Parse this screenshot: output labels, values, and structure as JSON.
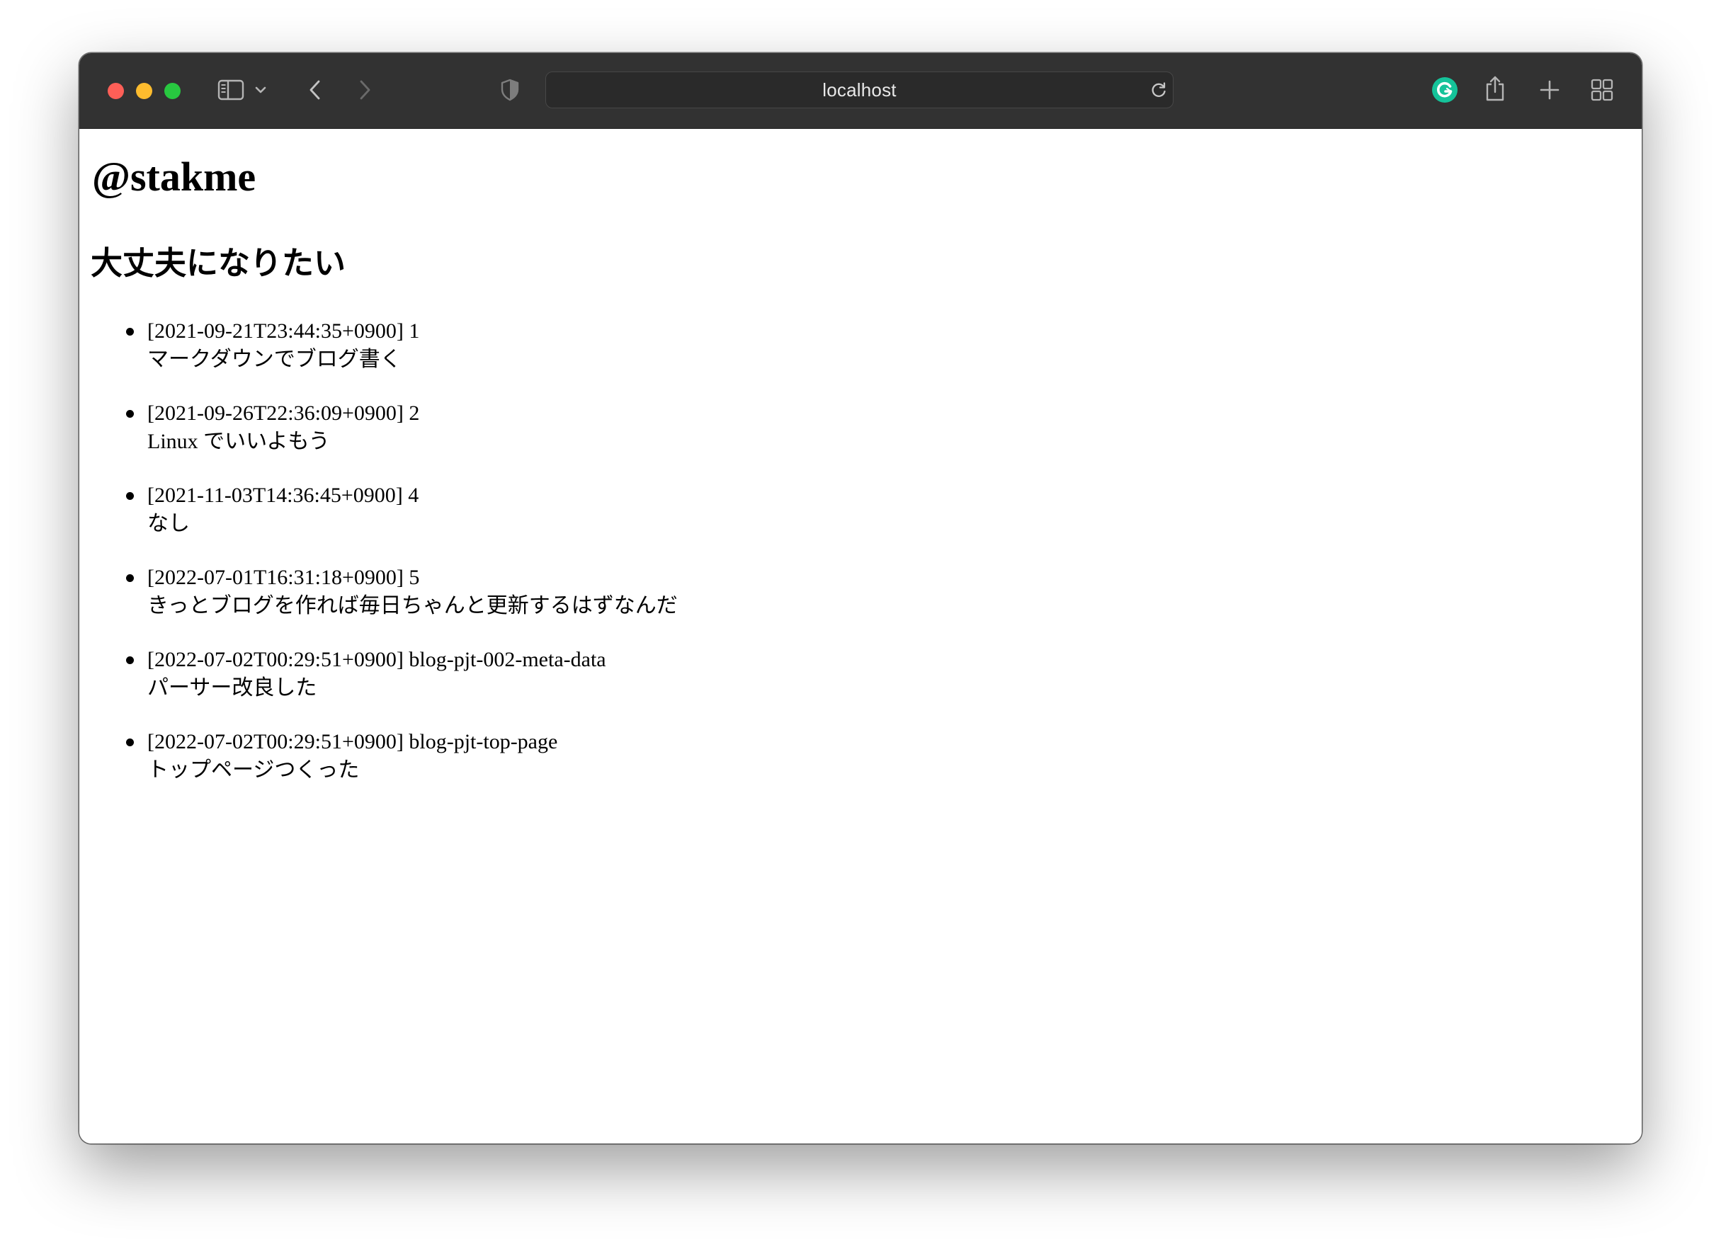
{
  "browser": {
    "address_bar": {
      "url": "localhost"
    },
    "icons": {
      "sidebar": "sidebar-icon",
      "chevron": "chevron-down-icon",
      "back": "back-arrow-icon",
      "forward": "forward-arrow-icon",
      "privacy": "shield-icon",
      "reload": "reload-icon",
      "extension": "grammarly-icon",
      "share": "share-icon",
      "new_tab": "plus-icon",
      "tabs": "tab-overview-icon"
    },
    "colors": {
      "toolbar": "#323232",
      "traffic_red": "#fe5f57",
      "traffic_yellow": "#febc2e",
      "traffic_green": "#28c840",
      "extension_green": "#15c39a"
    }
  },
  "page": {
    "site_title": "@stakme",
    "tagline": "大丈夫になりたい",
    "posts": [
      {
        "timestamp": "[2021-09-21T23:44:35+0900]",
        "slug": "1",
        "title": "マークダウンでブログ書く"
      },
      {
        "timestamp": "[2021-09-26T22:36:09+0900]",
        "slug": "2",
        "title": "Linux でいいよもう"
      },
      {
        "timestamp": "[2021-11-03T14:36:45+0900]",
        "slug": "4",
        "title": "なし"
      },
      {
        "timestamp": "[2022-07-01T16:31:18+0900]",
        "slug": "5",
        "title": "きっとブログを作れば毎日ちゃんと更新するはずなんだ"
      },
      {
        "timestamp": "[2022-07-02T00:29:51+0900]",
        "slug": "blog-pjt-002-meta-data",
        "title": "パーサー改良した"
      },
      {
        "timestamp": "[2022-07-02T00:29:51+0900]",
        "slug": "blog-pjt-top-page",
        "title": "トップページつくった"
      }
    ]
  }
}
